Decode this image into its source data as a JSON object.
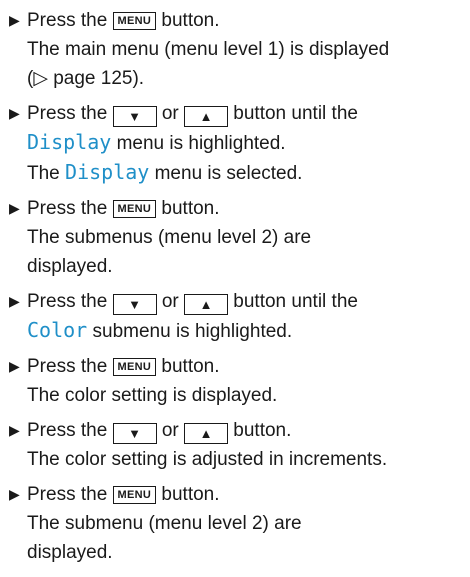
{
  "keys": {
    "menu": "MENU",
    "down": "▼",
    "up": "▲"
  },
  "bullet_glyph": "▶",
  "text": {
    "press_the": "Press the",
    "button": "button.",
    "or": "or",
    "button_until_the": "button until the",
    "menu_is_highlighted": "menu is highlighted.",
    "submenu_is_highlighted": "submenu is highlighted.",
    "main_menu_displayed": "The main menu (menu level 1) is displayed",
    "page_ref": "(▷ page 125).",
    "the": "The",
    "menu_is_selected": "menu is selected.",
    "submenus_line1": "The submenus (menu level 2) are",
    "displayed": "displayed.",
    "color_setting_displayed": "The color setting is displayed.",
    "color_adjusted": "The color setting is adjusted in increments.",
    "submenu_line1": "The submenu (menu level 2) are"
  },
  "menu_names": {
    "display": "Display",
    "color": "Color"
  }
}
